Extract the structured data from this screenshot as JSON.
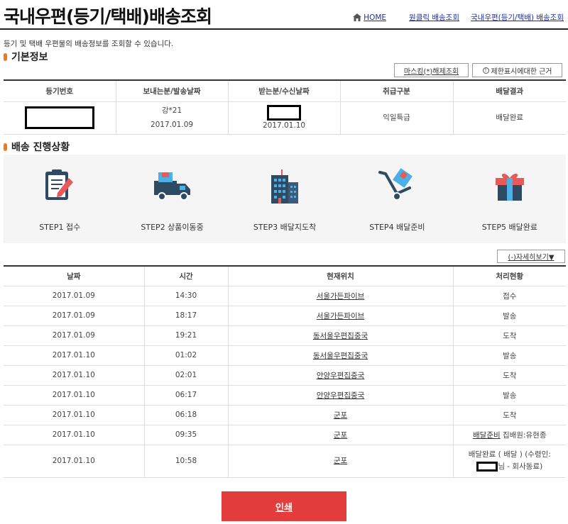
{
  "header": {
    "title": "국내우편(등기/택배)배송조회",
    "nav": {
      "home": "HOME",
      "link1": "원클릭 배송조회",
      "link2": "국내우편(등기/택배) 배송조회"
    }
  },
  "description": "등기 및 택배 우편물의 배송정보를 조회할 수 있습니다.",
  "basic_info": {
    "section_title": "기본정보",
    "buttons": {
      "masking": "마스킹(*)해제조회",
      "restriction": "제한표시에대한 근거"
    },
    "columns": [
      "등기번호",
      "보내는분/발송날짜",
      "받는분/수신날짜",
      "취급구분",
      "배달결과"
    ],
    "row": {
      "sender": "강*21",
      "send_date": "2017.01.09",
      "recv_date": "2017.01.10",
      "type": "익일특급",
      "result": "배달완료"
    }
  },
  "progress": {
    "section_title": "배송 진행상황",
    "steps": [
      {
        "label": "STEP1 접수",
        "icon": "clipboard-icon"
      },
      {
        "label": "STEP2 상품이동중",
        "icon": "truck-icon"
      },
      {
        "label": "STEP3 배달지도착",
        "icon": "building-icon"
      },
      {
        "label": "STEP4 배달준비",
        "icon": "hand-cart-icon"
      },
      {
        "label": "STEP5 배달완료",
        "icon": "gift-icon"
      }
    ],
    "detail_button": "(-)자세히보기▼"
  },
  "tracking": {
    "columns": [
      "날짜",
      "시간",
      "현재위치",
      "처리현황"
    ],
    "rows": [
      {
        "date": "2017.01.09",
        "time": "14:30",
        "location": "서울가든파이브",
        "status": "접수"
      },
      {
        "date": "2017.01.09",
        "time": "18:17",
        "location": "서울가든파이브",
        "status": "발송"
      },
      {
        "date": "2017.01.09",
        "time": "19:21",
        "location": "동서울우편집중국",
        "status": "도착"
      },
      {
        "date": "2017.01.10",
        "time": "01:02",
        "location": "동서울우편집중국",
        "status": "발송"
      },
      {
        "date": "2017.01.10",
        "time": "02:01",
        "location": "안양우편집중국",
        "status": "도착"
      },
      {
        "date": "2017.01.10",
        "time": "06:17",
        "location": "안양우편집중국",
        "status": "발송"
      },
      {
        "date": "2017.01.10",
        "time": "06:18",
        "location": "군포",
        "status": "도착"
      },
      {
        "date": "2017.01.10",
        "time": "09:35",
        "location": "군포",
        "status_link": "배달준비",
        "status_rest": " 집배원:유현종"
      },
      {
        "date": "2017.01.10",
        "time": "10:58",
        "location": "군포",
        "status_line1": "배달완료 ( 배달 ) (수령인:",
        "status_line2": "님 - 회사동료)"
      }
    ]
  },
  "print_button": "인쇄",
  "colors": {
    "accent_orange": "#f07a1a",
    "print_red": "#e23c3c",
    "link_blue": "#1f2f9c"
  }
}
